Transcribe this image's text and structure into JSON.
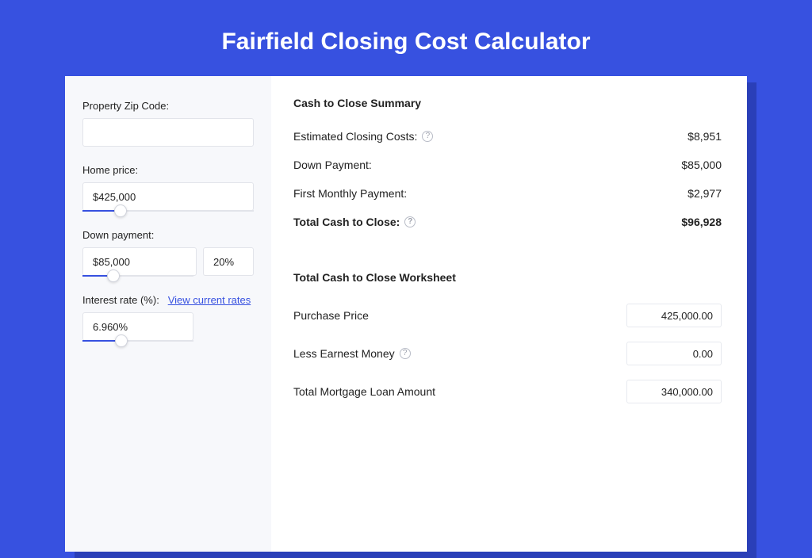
{
  "title": "Fairfield Closing Cost Calculator",
  "left": {
    "zip_label": "Property Zip Code:",
    "zip_value": "",
    "price_label": "Home price:",
    "price_value": "$425,000",
    "price_slider_pct": 22,
    "dp_label": "Down payment:",
    "dp_value": "$85,000",
    "dp_pct": "20%",
    "dp_slider_pct": 28,
    "rate_label": "Interest rate (%):",
    "rate_link": "View current rates",
    "rate_value": "6.960%",
    "rate_slider_pct": 35
  },
  "summary": {
    "title": "Cash to Close Summary",
    "rows": [
      {
        "label": "Estimated Closing Costs:",
        "help": true,
        "value": "$8,951"
      },
      {
        "label": "Down Payment:",
        "help": false,
        "value": "$85,000"
      },
      {
        "label": "First Monthly Payment:",
        "help": false,
        "value": "$2,977"
      }
    ],
    "total_label": "Total Cash to Close:",
    "total_value": "$96,928"
  },
  "worksheet": {
    "title": "Total Cash to Close Worksheet",
    "rows": [
      {
        "label": "Purchase Price",
        "help": false,
        "value": "425,000.00"
      },
      {
        "label": "Less Earnest Money",
        "help": true,
        "value": "0.00"
      },
      {
        "label": "Total Mortgage Loan Amount",
        "help": false,
        "value": "340,000.00"
      }
    ]
  }
}
